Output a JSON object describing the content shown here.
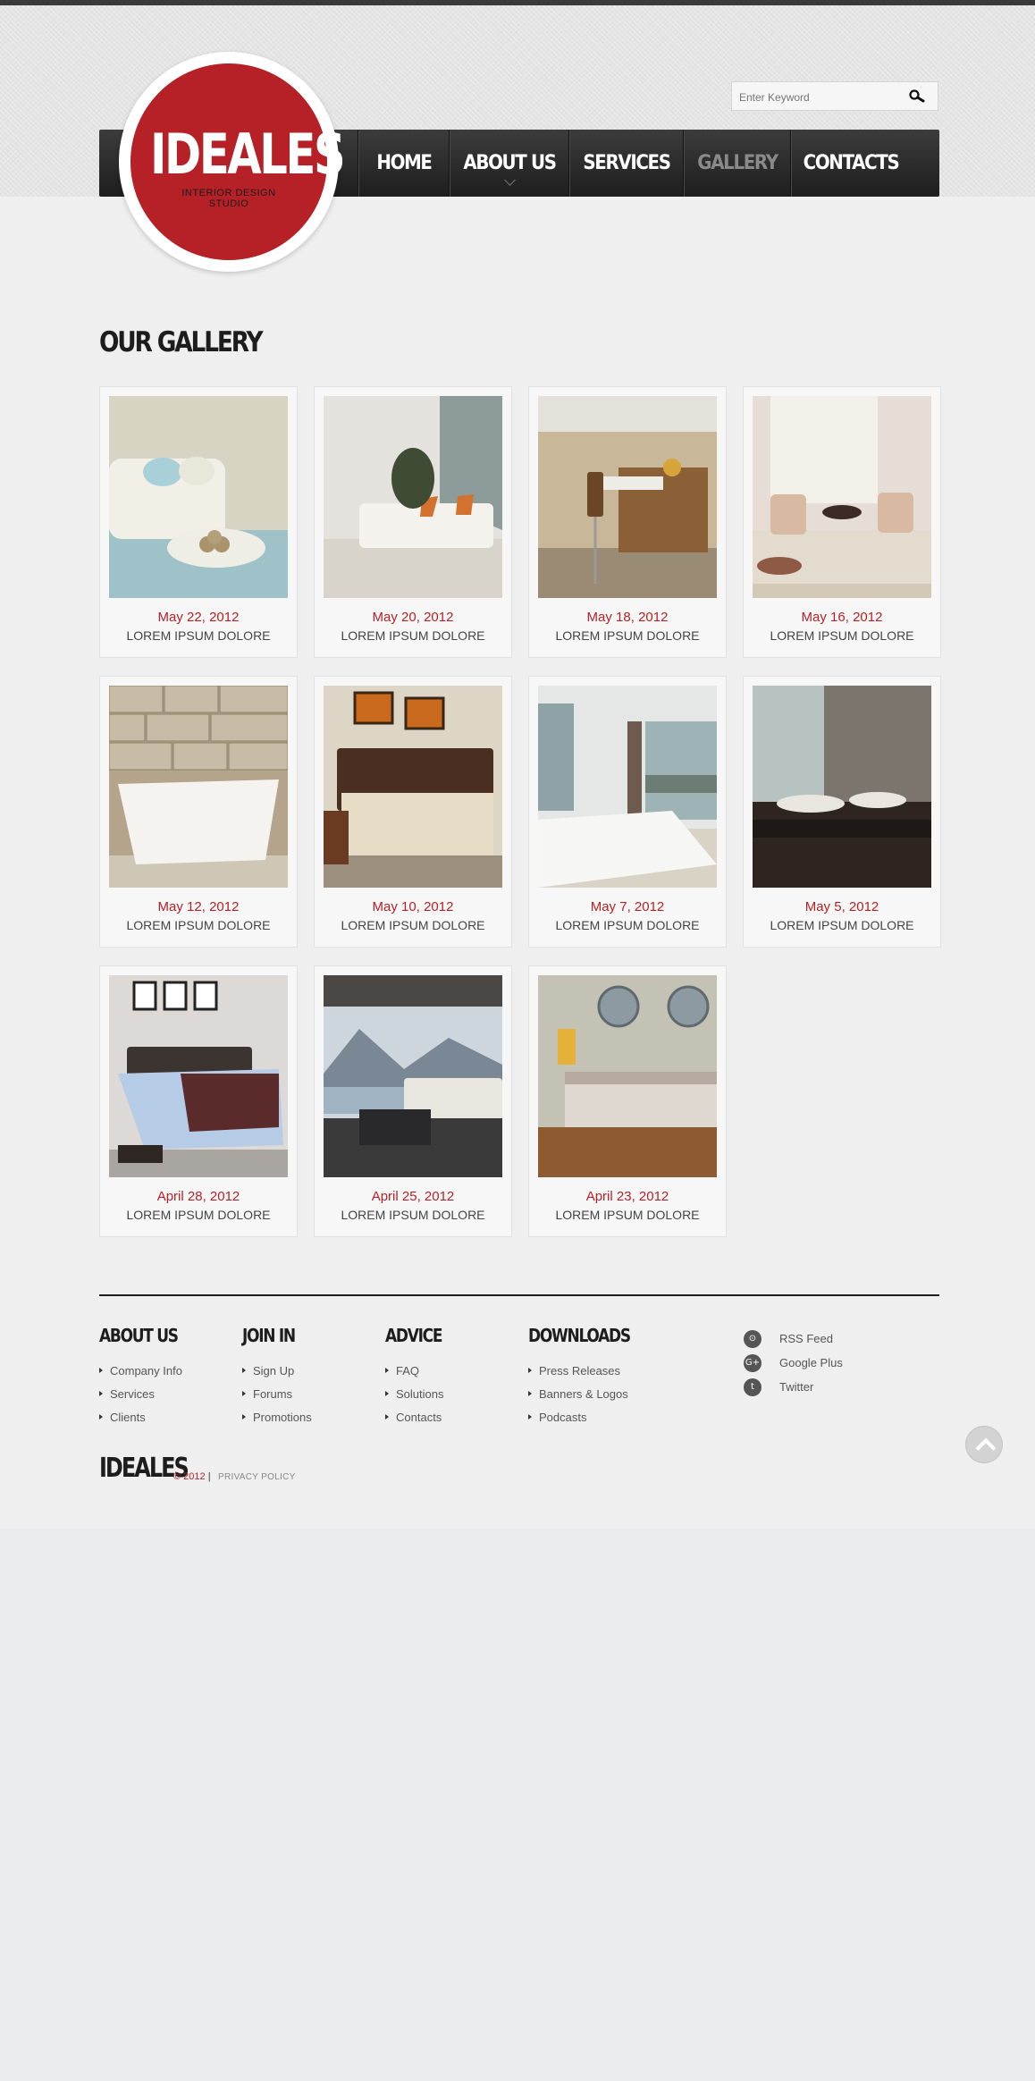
{
  "brand": {
    "name": "IDEALES",
    "subtitle_line1": "INTERIOR DESIGN",
    "subtitle_line2": "STUDIO",
    "accent_color": "#b52126"
  },
  "search": {
    "placeholder": "Enter Keyword",
    "icon": "search-icon"
  },
  "nav": {
    "items": [
      {
        "label": "HOME"
      },
      {
        "label": "ABOUT US"
      },
      {
        "label": "SERVICES"
      },
      {
        "label": "GALLERY",
        "active": true
      },
      {
        "label": "CONTACTS"
      }
    ]
  },
  "gallery": {
    "title": "OUR GALLERY",
    "items": [
      {
        "date": "May 22, 2012",
        "caption": "LOREM IPSUM DOLORE"
      },
      {
        "date": "May 20, 2012",
        "caption": "LOREM IPSUM DOLORE"
      },
      {
        "date": "May 18, 2012",
        "caption": "LOREM IPSUM DOLORE"
      },
      {
        "date": "May 16, 2012",
        "caption": "LOREM IPSUM DOLORE"
      },
      {
        "date": "May 12, 2012",
        "caption": "LOREM IPSUM DOLORE"
      },
      {
        "date": "May 10, 2012",
        "caption": "LOREM IPSUM DOLORE"
      },
      {
        "date": "May 7, 2012",
        "caption": "LOREM IPSUM DOLORE"
      },
      {
        "date": "May 5, 2012",
        "caption": "LOREM IPSUM DOLORE"
      },
      {
        "date": "April 28, 2012",
        "caption": "LOREM IPSUM DOLORE"
      },
      {
        "date": "April 25, 2012",
        "caption": "LOREM IPSUM DOLORE"
      },
      {
        "date": "April 23, 2012",
        "caption": "LOREM IPSUM DOLORE"
      }
    ]
  },
  "footer": {
    "columns": [
      {
        "title": "ABOUT US",
        "links": [
          "Company Info",
          "Services",
          "Clients"
        ]
      },
      {
        "title": "JOIN IN",
        "links": [
          "Sign Up",
          "Forums",
          "Promotions"
        ]
      },
      {
        "title": "ADVICE",
        "links": [
          "FAQ",
          "Solutions",
          "Contacts"
        ]
      },
      {
        "title": "DOWNLOADS",
        "links": [
          "Press Releases",
          "Banners & Logos",
          "Podcasts"
        ]
      }
    ],
    "social": [
      {
        "label": "RSS Feed",
        "icon": "rss-icon",
        "glyph": "⊙"
      },
      {
        "label": "Google Plus",
        "icon": "google-plus-icon",
        "glyph": "G+"
      },
      {
        "label": "Twitter",
        "icon": "twitter-icon",
        "glyph": "t"
      }
    ],
    "brand": "IDEALES",
    "copyright": "© 2012",
    "separator": "|",
    "privacy": "PRIVACY POLICY"
  }
}
